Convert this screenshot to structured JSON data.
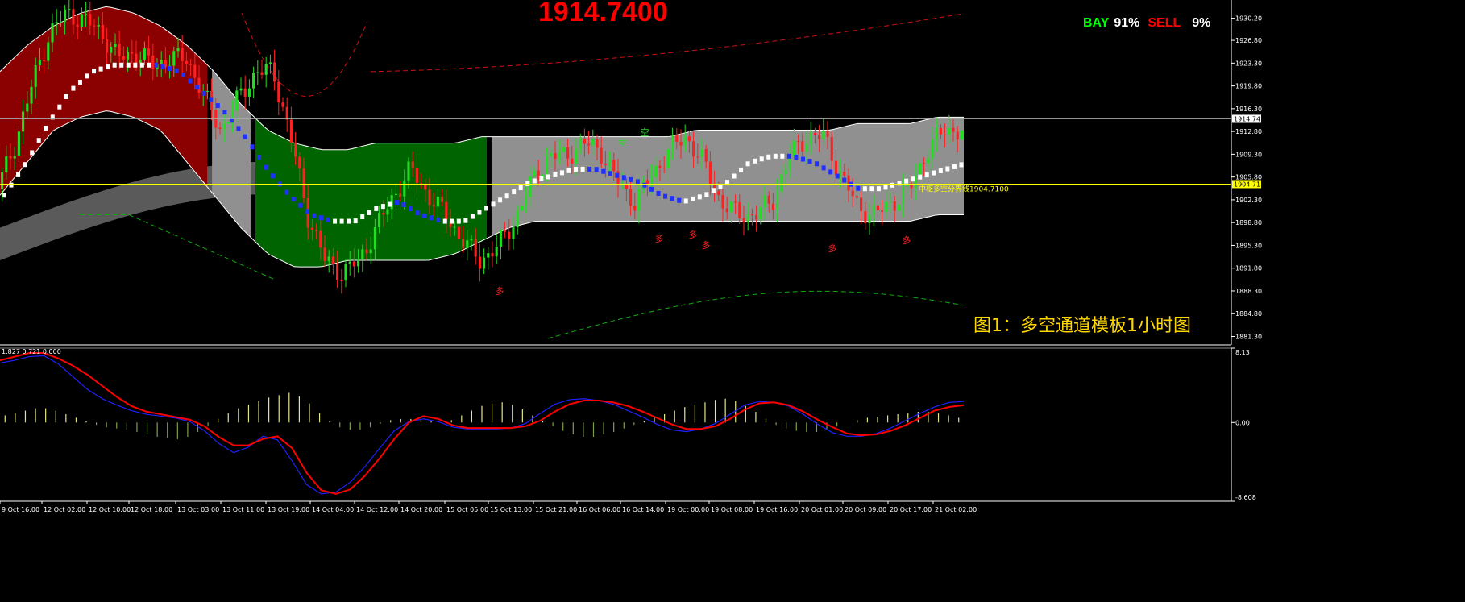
{
  "header": {
    "big_price": "1914.7400",
    "bay_label": "BAY",
    "bay_pct": "91%",
    "sell_label": "SELL",
    "sell_pct": "9%",
    "caption": "图1：多空通道模板1小时图",
    "indicator_values": "1.827 0.721 0.000",
    "level_label": "中枢多空分界线1904.7100"
  },
  "colors": {
    "background": "#000000",
    "bull": "#22dd22",
    "bear": "#ff2020",
    "red_fill": "#8b0000",
    "green_fill": "#006400",
    "gray_fill": "#909090",
    "dark_gray_fill": "#5a5a5a",
    "ma_blue": "#2030ff",
    "ma_white": "#ffffff",
    "level_yellow": "#ffff00",
    "osc_red": "#ff0000",
    "osc_blue": "#2020ff",
    "hist_yellow": "#e6e68a",
    "hist_green": "#7fa04a",
    "text_green": "#00ff00",
    "text_red": "#ff0000"
  },
  "chart_data": [
    {
      "type": "candlestick",
      "ylim": [
        1880.0,
        1933.0
      ],
      "y_ticks": [
        "1930.20",
        "1926.80",
        "1923.30",
        "1919.80",
        "1916.30",
        "1912.80",
        "1909.30",
        "1905.80",
        "1902.30",
        "1898.80",
        "1895.30",
        "1891.80",
        "1888.30",
        "1884.80",
        "1881.30"
      ],
      "current_price": 1914.74,
      "current_price_label": "1914.74",
      "pivot_level": 1904.71,
      "pivot_label": "1904.71",
      "x_labels": [
        "9 Oct 16:00",
        "12 Oct 02:00",
        "12 Oct 10:00",
        "12 Oct 18:00",
        "13 Oct 03:00",
        "13 Oct 11:00",
        "13 Oct 19:00",
        "14 Oct 04:00",
        "14 Oct 12:00",
        "14 Oct 20:00",
        "15 Oct 05:00",
        "15 Oct 13:00",
        "15 Oct 21:00",
        "16 Oct 06:00",
        "16 Oct 14:00",
        "19 Oct 00:00",
        "19 Oct 08:00",
        "19 Oct 16:00",
        "20 Oct 01:00",
        "20 Oct 09:00",
        "20 Oct 17:00",
        "21 Oct 02:00"
      ],
      "markers": [
        "多",
        "多",
        "多",
        "多",
        "多",
        "多",
        "空",
        "空"
      ],
      "close_path": [
        1904,
        1911,
        1920,
        1928,
        1931,
        1930,
        1928,
        1924,
        1925,
        1923,
        1924,
        1924,
        1918,
        1913,
        1918,
        1922,
        1922,
        1912,
        1900,
        1893,
        1891,
        1893,
        1898,
        1903,
        1907,
        1903,
        1900,
        1896,
        1893,
        1895,
        1899,
        1905,
        1909,
        1909,
        1911,
        1910,
        1905,
        1902,
        1906,
        1910,
        1912,
        1908,
        1902,
        1900,
        1900,
        1902,
        1909,
        1912,
        1912,
        1906,
        1901,
        1900,
        1902,
        1904,
        1910,
        1913,
        1913
      ],
      "band_upper": [
        1922,
        1926,
        1929,
        1931,
        1932,
        1931,
        1929,
        1926,
        1922,
        1917,
        1913,
        1911,
        1910,
        1910,
        1911,
        1911,
        1911,
        1911,
        1912,
        1912,
        1912,
        1912,
        1912,
        1912,
        1912,
        1912,
        1913,
        1913,
        1913,
        1913,
        1913,
        1913,
        1914,
        1914,
        1914,
        1915,
        1915
      ],
      "band_lower": [
        1903,
        1908,
        1913,
        1915,
        1916,
        1915,
        1913,
        1908,
        1903,
        1898,
        1894,
        1892,
        1892,
        1893,
        1893,
        1893,
        1893,
        1894,
        1896,
        1898,
        1899,
        1899,
        1899,
        1899,
        1899,
        1899,
        1899,
        1899,
        1899,
        1899,
        1899,
        1899,
        1899,
        1899,
        1899,
        1900,
        1900
      ],
      "ma_path": [
        1903,
        1908,
        1914,
        1919,
        1922,
        1923,
        1923,
        1923,
        1922,
        1919,
        1916,
        1912,
        1907,
        1903,
        1900,
        1899,
        1899,
        1901,
        1902,
        1900,
        1899,
        1899,
        1901,
        1903,
        1905,
        1906,
        1907,
        1907,
        1906,
        1905,
        1903,
        1902,
        1903,
        1905,
        1908,
        1909,
        1909,
        1908,
        1906,
        1904,
        1904,
        1905,
        1906,
        1907,
        1908
      ]
    },
    {
      "type": "line",
      "ylim": [
        -8.608,
        8.13
      ],
      "y_ticks": [
        "8.13",
        "0.00",
        "-8.608"
      ],
      "series": [
        {
          "values": [
            6.8,
            7.2,
            7.6,
            7.6,
            7.0,
            6.2,
            5.2,
            4.0,
            2.8,
            1.8,
            1.2,
            0.9,
            0.6,
            0.3,
            -0.4,
            -1.6,
            -2.5,
            -2.5,
            -1.8,
            -1.5,
            -2.8,
            -5.5,
            -7.4,
            -7.8,
            -7.3,
            -5.8,
            -3.9,
            -1.8,
            0.0,
            0.7,
            0.4,
            -0.3,
            -0.6,
            -0.6,
            -0.6,
            -0.6,
            -0.4,
            0.2,
            1.2,
            2.0,
            2.4,
            2.4,
            2.2,
            1.8,
            1.2,
            0.5,
            -0.2,
            -0.7,
            -0.7,
            -0.4,
            0.4,
            1.4,
            2.1,
            2.2,
            1.9,
            1.2,
            0.3,
            -0.5,
            -1.2,
            -1.4,
            -1.3,
            -0.9,
            -0.3,
            0.5,
            1.3,
            1.7,
            1.9
          ]
        },
        {
          "values": [
            6.5,
            6.8,
            7.2,
            7.3,
            6.4,
            5.0,
            3.6,
            2.6,
            1.9,
            1.3,
            0.9,
            0.7,
            0.5,
            0.1,
            -0.9,
            -2.3,
            -3.3,
            -2.7,
            -1.5,
            -1.9,
            -4.2,
            -6.8,
            -7.8,
            -7.6,
            -6.5,
            -4.8,
            -2.8,
            -0.9,
            0.1,
            0.4,
            0.1,
            -0.5,
            -0.7,
            -0.7,
            -0.7,
            -0.6,
            -0.1,
            1.0,
            2.0,
            2.5,
            2.6,
            2.4,
            2.0,
            1.3,
            0.6,
            -0.2,
            -0.8,
            -1.0,
            -0.7,
            -0.1,
            0.9,
            1.9,
            2.3,
            2.2,
            1.8,
            0.9,
            -0.2,
            -1.1,
            -1.5,
            -1.5,
            -1.2,
            -0.6,
            0.2,
            1.0,
            1.7,
            2.2,
            2.3
          ]
        }
      ],
      "histogram": [
        0.6,
        0.8,
        1.0,
        1.2,
        1.2,
        1.0,
        0.7,
        0.4,
        0.1,
        -0.2,
        -0.4,
        -0.5,
        -0.6,
        -0.8,
        -1.0,
        -1.2,
        -1.3,
        -1.4,
        -1.2,
        -0.8,
        -0.3,
        0.3,
        0.8,
        1.2,
        1.5,
        1.8,
        2.1,
        2.3,
        2.5,
        2.2,
        1.6,
        0.8,
        0.1,
        -0.4,
        -0.6,
        -0.6,
        -0.4,
        -0.1,
        0.2,
        0.3,
        0.3,
        0.2,
        0.1,
        0.0,
        0.2,
        0.6,
        1.0,
        1.4,
        1.6,
        1.7,
        1.5,
        1.1,
        0.6,
        0.1,
        -0.3,
        -0.7,
        -1.0,
        -1.2,
        -1.2,
        -1.0,
        -0.8,
        -0.5,
        -0.2,
        0.1,
        0.4,
        0.7,
        1.0,
        1.3,
        1.5,
        1.7,
        1.9,
        2.0,
        1.8,
        1.4,
        0.9,
        0.3,
        -0.2,
        -0.5,
        -0.7,
        -0.8,
        -0.8,
        -0.6,
        -0.3,
        0.0,
        0.2,
        0.4,
        0.5,
        0.6,
        0.7,
        0.8,
        0.9,
        0.9,
        0.8,
        0.6,
        0.4
      ]
    }
  ]
}
